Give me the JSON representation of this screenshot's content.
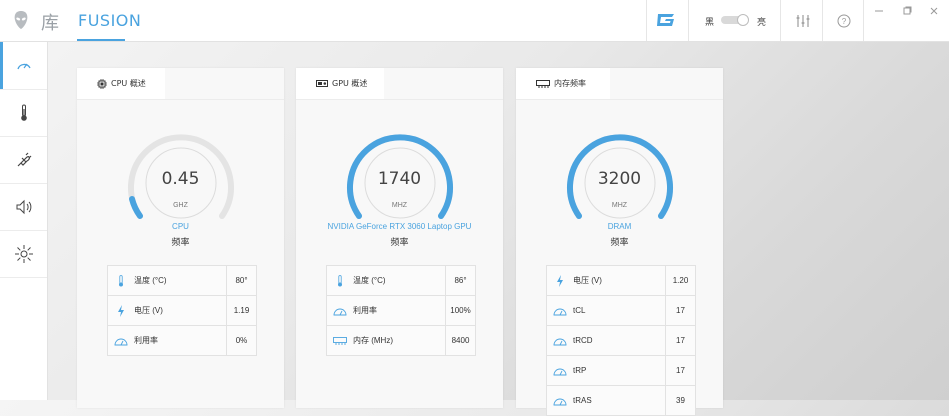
{
  "header": {
    "nav_library": "库",
    "nav_fusion": "FUSION",
    "theme_dark": "黑",
    "theme_light": "亮",
    "accent": "#4aa3df"
  },
  "sidebar": {
    "items": [
      {
        "icon": "gauge-icon",
        "active": true
      },
      {
        "icon": "thermometer-icon"
      },
      {
        "icon": "plug-icon"
      },
      {
        "icon": "speaker-icon"
      },
      {
        "icon": "brightness-icon"
      }
    ]
  },
  "cards": [
    {
      "tab_label": "CPU 概述",
      "gauge_value": "0.45",
      "gauge_unit": "GHZ",
      "gauge_name": "CPU",
      "gauge_sub": "频率",
      "stats": [
        {
          "icon": "thermometer-icon",
          "label": "温度 (°C)",
          "value": "80°"
        },
        {
          "icon": "bolt-icon",
          "label": "电压 (V)",
          "value": "1.19"
        },
        {
          "icon": "usage-icon",
          "label": "利用率",
          "value": "0%"
        }
      ]
    },
    {
      "tab_label": "GPU 概述",
      "gauge_value": "1740",
      "gauge_unit": "MHZ",
      "gauge_name": "NVIDIA GeForce RTX 3060 Laptop GPU",
      "gauge_sub": "频率",
      "stats": [
        {
          "icon": "thermometer-icon",
          "label": "温度 (°C)",
          "value": "86°"
        },
        {
          "icon": "usage-icon",
          "label": "利用率",
          "value": "100%"
        },
        {
          "icon": "memory-icon",
          "label": "内存 (MHz)",
          "value": "8400"
        }
      ]
    },
    {
      "tab_label": "内存频率",
      "gauge_value": "3200",
      "gauge_unit": "MHZ",
      "gauge_name": "DRAM",
      "gauge_sub": "频率",
      "stats": [
        {
          "icon": "bolt-icon",
          "label": "电压 (V)",
          "value": "1.20"
        },
        {
          "icon": "usage-icon",
          "label": "tCL",
          "value": "17"
        },
        {
          "icon": "usage-icon",
          "label": "tRCD",
          "value": "17"
        },
        {
          "icon": "usage-icon",
          "label": "tRP",
          "value": "17"
        },
        {
          "icon": "usage-icon",
          "label": "tRAS",
          "value": "39"
        }
      ]
    }
  ]
}
